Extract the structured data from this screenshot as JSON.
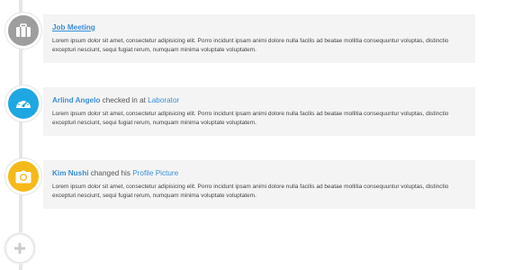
{
  "timeline": {
    "items": [
      {
        "icon": "briefcase-icon",
        "icon_color": "#9e9e9e",
        "title_link": "Job Meeting",
        "body": "Lorem ipsum dolor sit amet, consectetur adipisicing elit. Porro incidunt ipsam animi dolore nulla facilis ad beatae mollitia consequuntur voluptas, distinctio excepturi nesciunt, sequi fugiat rerum, numquam minima voluptate voluptatem."
      },
      {
        "icon": "dashboard-icon",
        "icon_color": "#1ea7e1",
        "user": "Arlind Angelo",
        "action": " checked in at ",
        "target": "Laborator",
        "body": "Lorem ipsum dolor sit amet, consectetur adipisicing elit. Porro incidunt ipsam animi dolore nulla facilis ad beatae mollitia consequuntur voluptas, distinctio excepturi nesciunt, sequi fugiat rerum, numquam minima voluptate voluptatem."
      },
      {
        "icon": "camera-icon",
        "icon_color": "#f5b919",
        "user": "Kim Nushi",
        "action": " changed his ",
        "target": "Profile Picture",
        "body": "Lorem ipsum dolor sit amet, consectetur adipisicing elit. Porro incidunt ipsam animi dolore nulla facilis ad beatae mollitia consequuntur voluptas, distinctio excepturi nesciunt, sequi fugiat rerum, numquam minima voluptate voluptatem."
      }
    ],
    "add_button": {
      "icon": "plus-icon",
      "icon_color": "#cccccc"
    }
  }
}
